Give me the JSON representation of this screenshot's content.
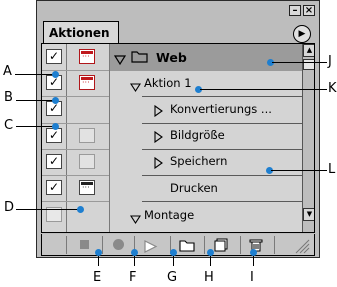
{
  "palette": {
    "tab_title": "Aktionen",
    "window_controls": {
      "minimize": "–",
      "close": "×"
    },
    "menu_button": "▶"
  },
  "rows": [
    {
      "label": "Web",
      "type": "set",
      "expanded": true
    },
    {
      "label": "Aktion 1",
      "type": "action",
      "expanded": true
    },
    {
      "label": "Konvertierungs ...",
      "type": "command",
      "expanded": false
    },
    {
      "label": "Bildgröße",
      "type": "command",
      "expanded": false
    },
    {
      "label": "Speichern",
      "type": "command",
      "expanded": false
    },
    {
      "label": "Drucken",
      "type": "command"
    },
    {
      "label": "Montage",
      "type": "action",
      "expanded": true
    }
  ],
  "bottom_buttons": [
    "stop-recording",
    "record",
    "play",
    "new-set",
    "new-action",
    "delete"
  ],
  "callouts": {
    "A": "A",
    "B": "B",
    "C": "C",
    "D": "D",
    "E": "E",
    "F": "F",
    "G": "G",
    "H": "H",
    "I": "I",
    "J": "J",
    "K": "K",
    "L": "L"
  },
  "colors": {
    "callout_dot": "#1e7fd0",
    "dialog_icon_red": "#c0181c",
    "selected_set_row": "#9b9b9b"
  }
}
